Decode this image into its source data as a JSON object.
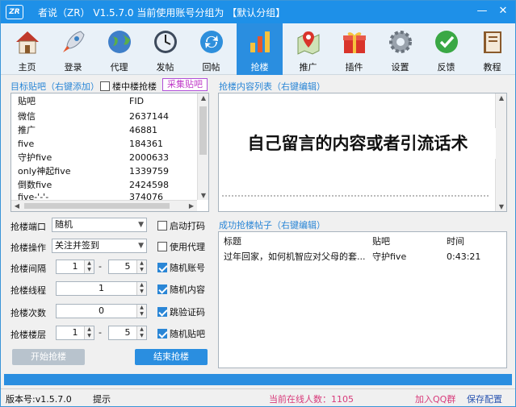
{
  "titlebar": {
    "logo_text": "ZR",
    "title": "者说（ZR）  V1.5.7.0  当前使用账号分组为  【默认分组】",
    "minimize": "—",
    "close": "✕"
  },
  "toolbar": {
    "items": [
      {
        "label": "主页",
        "icon": "home-icon"
      },
      {
        "label": "登录",
        "icon": "rocket-icon"
      },
      {
        "label": "代理",
        "icon": "globe-icon"
      },
      {
        "label": "发帖",
        "icon": "clock-icon"
      },
      {
        "label": "回帖",
        "icon": "refresh-icon"
      },
      {
        "label": "抢楼",
        "icon": "bar-chart-icon",
        "active": true
      },
      {
        "label": "推广",
        "icon": "map-pin-icon"
      },
      {
        "label": "插件",
        "icon": "gift-icon"
      },
      {
        "label": "设置",
        "icon": "gear-icon"
      },
      {
        "label": "反馈",
        "icon": "check-icon"
      },
      {
        "label": "教程",
        "icon": "book-icon"
      }
    ]
  },
  "left": {
    "target_label": "目标贴吧（右键添加）",
    "mid_floor_label": "楼中楼抢楼",
    "collect_button": "采集贴吧",
    "columns": [
      "贴吧",
      "FID"
    ],
    "rows": [
      {
        "name": "微信",
        "fid": "2637144"
      },
      {
        "name": "推广",
        "fid": "46881"
      },
      {
        "name": "five",
        "fid": "184361"
      },
      {
        "name": "守护five",
        "fid": "2000633"
      },
      {
        "name": "only神起five",
        "fid": "1339759"
      },
      {
        "name": "倒数five",
        "fid": "2424598"
      },
      {
        "name": "five-'-'-",
        "fid": "374076"
      }
    ]
  },
  "right": {
    "content_label": "抢楼内容列表（右键编辑）",
    "content_overlay": "自己留言的内容或者引流话术",
    "success_label": "成功抢楼帖子（右键编辑）",
    "columns": [
      "标题",
      "贴吧",
      "时间"
    ],
    "rows": [
      {
        "title": "过年回家，如何机智应对父母的套...",
        "bar": "守护five",
        "time": "0:43:21"
      }
    ]
  },
  "form": {
    "port_label": "抢楼端口",
    "port_value": "随机",
    "action_label": "抢楼操作",
    "action_value": "关注并签到",
    "interval_label": "抢楼间隔",
    "interval_min": "1",
    "interval_max": "5",
    "threads_label": "抢楼线程",
    "threads_value": "1",
    "count_label": "抢楼次数",
    "count_value": "0",
    "floor_label": "抢楼楼层",
    "floor_min": "1",
    "floor_max": "5",
    "dash": "-",
    "options": [
      {
        "label": "启动打码",
        "checked": false
      },
      {
        "label": "使用代理",
        "checked": false
      },
      {
        "label": "随机账号",
        "checked": true
      },
      {
        "label": "随机内容",
        "checked": true
      },
      {
        "label": "跳验证码",
        "checked": true
      },
      {
        "label": "随机贴吧",
        "checked": true
      }
    ],
    "start_button": "开始抢楼",
    "stop_button": "结束抢楼"
  },
  "progress": {
    "value": 1.0
  },
  "status": {
    "version": "版本号:v1.5.7.0",
    "hint": "提示",
    "online": "当前在线人数：1105",
    "join_qq": "加入QQ群",
    "save": "保存配置"
  },
  "colors": {
    "accent": "#1e90e8",
    "active_tab": "#2a8ee0",
    "link": "#2a86d6",
    "online_text": "#d83a7a",
    "collect_text": "#c03ac8"
  }
}
